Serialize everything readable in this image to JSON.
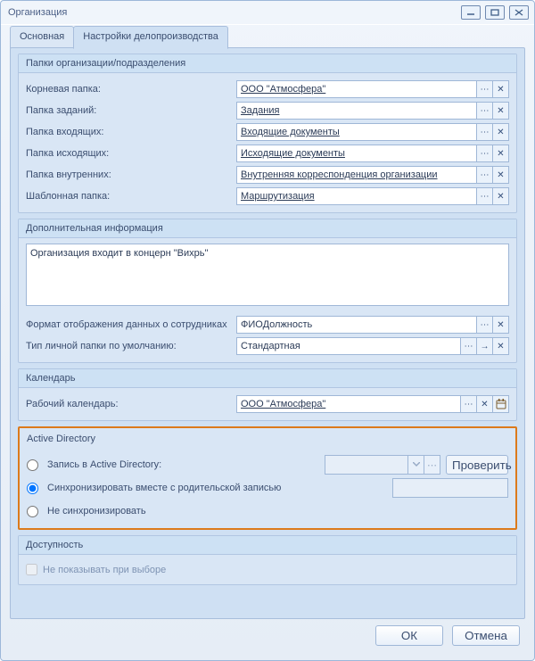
{
  "window": {
    "title": "Организация"
  },
  "tabs": {
    "main": "Основная",
    "docflow": "Настройки делопроизводства"
  },
  "folders": {
    "legend": "Папки организации/подразделения",
    "root_label": "Корневая папка:",
    "root_value": "ООО \"Атмосфера\"",
    "tasks_label": "Папка заданий:",
    "tasks_value": "Задания",
    "incoming_label": "Папка входящих:",
    "incoming_value": "Входящие документы",
    "outgoing_label": "Папка исходящих:",
    "outgoing_value": "Исходящие документы",
    "internal_label": "Папка внутренних:",
    "internal_value": "Внутренняя корреспонденция организации",
    "template_label": "Шаблонная папка:",
    "template_value": "Маршрутизация"
  },
  "extra": {
    "legend": "Дополнительная информация",
    "memo": "Организация входит в концерн \"Вихрь\"",
    "emp_display_label": "Формат отображения данных о сотрудниках",
    "emp_display_value": "ФИОДолжность",
    "personal_folder_label": "Тип личной папки по умолчанию:",
    "personal_folder_value": "Стандартная"
  },
  "calendar": {
    "legend": "Календарь",
    "label": "Рабочий календарь:",
    "value": "ООО \"Атмосфера\""
  },
  "ad": {
    "legend": "Active Directory",
    "opt_record": "Запись в Active Directory:",
    "opt_sync": "Синхронизировать вместе с родительской записью",
    "opt_nosync": "Не синхронизировать",
    "check_btn": "Проверить"
  },
  "avail": {
    "legend": "Доступность",
    "hide": "Не показывать при выборе"
  },
  "buttons": {
    "ok": "ОК",
    "cancel": "Отмена"
  },
  "glyphs": {
    "ellipsis": "⋯",
    "close": "✕",
    "rarrow": "→"
  }
}
